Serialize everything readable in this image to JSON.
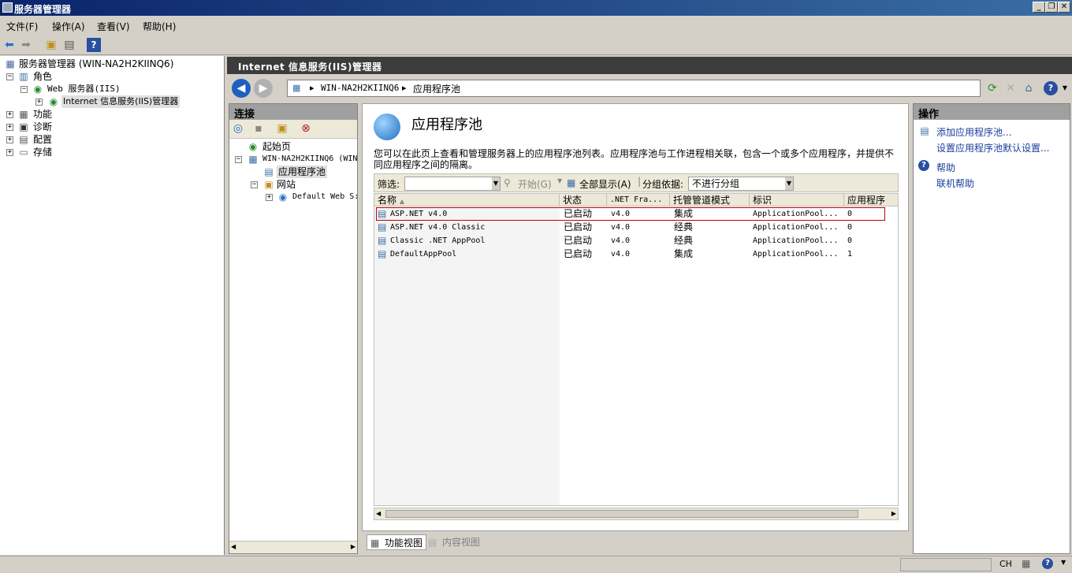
{
  "window": {
    "title": "服务器管理器"
  },
  "menu": [
    "文件(F)",
    "操作(A)",
    "查看(V)",
    "帮助(H)"
  ],
  "tree": {
    "root": "服务器管理器 (WIN-NA2H2KIINQ6)",
    "roles": "角色",
    "web_server": "Web 服务器(IIS)",
    "iis_manager": "Internet 信息服务(IIS)管理器",
    "features": "功能",
    "diagnostics": "诊断",
    "configuration": "配置",
    "storage": "存储"
  },
  "iis_header": "Internet 信息服务(IIS)管理器",
  "address": {
    "server": "WIN-NA2H2KIINQ6",
    "page": "应用程序池"
  },
  "connections": {
    "title": "连接",
    "start_page": "起始页",
    "server_node": "WIN-NA2H2KIINQ6 (WIN",
    "app_pools": "应用程序池",
    "sites": "网站",
    "default_site": "Default Web S:"
  },
  "center": {
    "title": "应用程序池",
    "description": "您可以在此页上查看和管理服务器上的应用程序池列表。应用程序池与工作进程相关联，包含一个或多个应用程序，并提供不同应用程序之间的隔离。",
    "filter_label": "筛选:",
    "start_label": "开始(G)",
    "show_all_label": "全部显示(A)",
    "group_label": "分组依据:",
    "group_value": "不进行分组",
    "columns": [
      "名称",
      "状态",
      ".NET Fra...",
      "托管管道模式",
      "标识",
      "应用程序"
    ],
    "rows": [
      {
        "name": "ASP.NET v4.0",
        "status": "已启动",
        "net": "v4.0",
        "mode": "集成",
        "identity": "ApplicationPool...",
        "apps": "0"
      },
      {
        "name": "ASP.NET v4.0 Classic",
        "status": "已启动",
        "net": "v4.0",
        "mode": "经典",
        "identity": "ApplicationPool...",
        "apps": "0"
      },
      {
        "name": "Classic .NET AppPool",
        "status": "已启动",
        "net": "v4.0",
        "mode": "经典",
        "identity": "ApplicationPool...",
        "apps": "0"
      },
      {
        "name": "DefaultAppPool",
        "status": "已启动",
        "net": "v4.0",
        "mode": "集成",
        "identity": "ApplicationPool...",
        "apps": "1"
      }
    ]
  },
  "actions": {
    "title": "操作",
    "add_pool": "添加应用程序池...",
    "set_defaults": "设置应用程序池默认设置...",
    "help": "帮助",
    "online_help": "联机帮助"
  },
  "view_tabs": {
    "features": "功能视图",
    "content": "内容视图"
  },
  "status": {
    "lang": "CH"
  },
  "colors": {
    "title_start": "#0a246a",
    "title_end": "#3a6ea5",
    "header_bg": "#3c3c3c",
    "link": "#1a3c9c",
    "selected_border": "#c00000"
  }
}
